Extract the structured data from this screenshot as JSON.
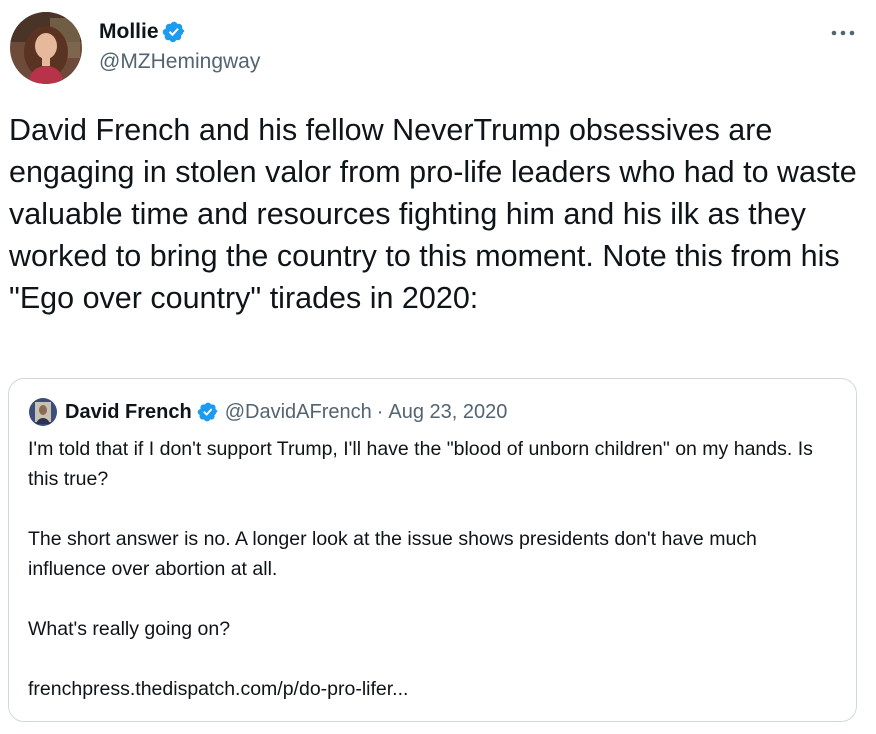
{
  "author": {
    "name": "Mollie",
    "handle": "@MZHemingway"
  },
  "tweet": {
    "text": "David French and his fellow NeverTrump obsessives are engaging in stolen valor from pro-life leaders who had to waste valuable time and resources fighting him and his ilk as they worked to bring the country to this moment. Note this from his \"Ego over country\" tirades in 2020:"
  },
  "quoted_tweet": {
    "name": "David French",
    "handle": "@DavidAFrench",
    "separator": "·",
    "date": "Aug 23, 2020",
    "paragraphs": [
      "I'm told that if I don't support Trump, I'll have the \"blood of unborn children\" on my hands. Is this true?",
      "The short answer is no. A longer look at the issue shows presidents don't have much influence over abortion at all.",
      "What's really going on?",
      "frenchpress.thedispatch.com/p/do-pro-lifer..."
    ]
  },
  "icons": {
    "verified": "verified-badge-icon",
    "more": "more-options-icon"
  },
  "colors": {
    "verified_blue": "#1d9bf0",
    "secondary_text": "#536471",
    "border": "#cfd9de",
    "primary_text": "#0f1419"
  }
}
